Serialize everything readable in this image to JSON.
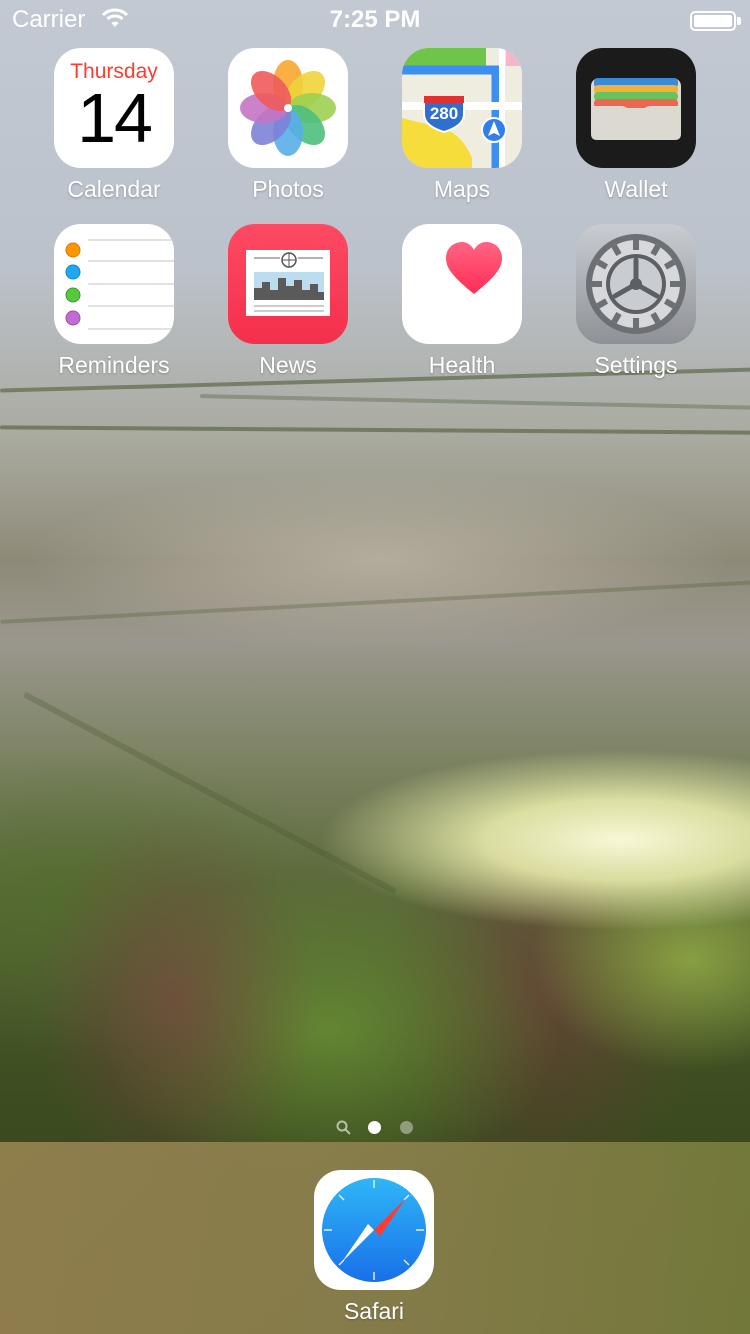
{
  "status_bar": {
    "carrier": "Carrier",
    "time": "7:25 PM",
    "battery_level": 1.0
  },
  "home_screen": {
    "apps": [
      {
        "label": "Calendar",
        "icon": "calendar-icon",
        "weekday": "Thursday",
        "day": "14"
      },
      {
        "label": "Photos",
        "icon": "photos-icon"
      },
      {
        "label": "Maps",
        "icon": "maps-icon",
        "shield_number": "280"
      },
      {
        "label": "Wallet",
        "icon": "wallet-icon"
      },
      {
        "label": "Reminders",
        "icon": "reminders-icon"
      },
      {
        "label": "News",
        "icon": "news-icon"
      },
      {
        "label": "Health",
        "icon": "health-icon"
      },
      {
        "label": "Settings",
        "icon": "settings-icon"
      }
    ]
  },
  "page_indicator": {
    "pages": 2,
    "current": 1
  },
  "dock": {
    "apps": [
      {
        "label": "Safari",
        "icon": "safari-icon"
      }
    ]
  },
  "colors": {
    "calendar_red": "#ff3b30",
    "news_red": "#fc3159",
    "health_red": "#ff2d55",
    "wallet_black": "#1b1b1b",
    "safari_blue": "#1a8cf0"
  }
}
